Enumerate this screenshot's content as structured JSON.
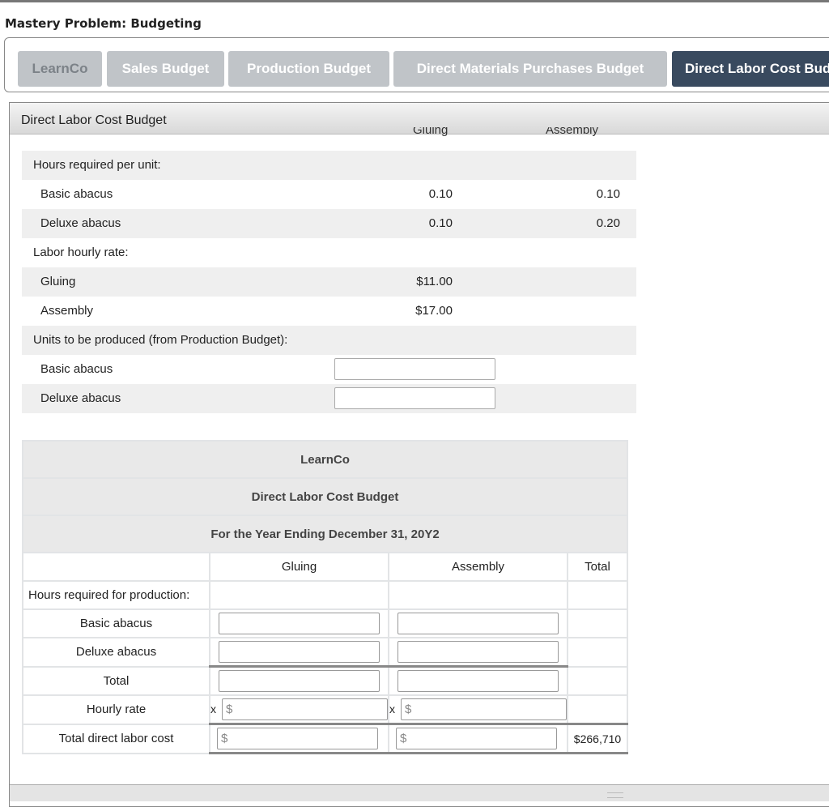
{
  "title": "Mastery Problem: Budgeting",
  "tabs": [
    {
      "label": "LearnCo"
    },
    {
      "label": "Sales Budget"
    },
    {
      "label": "Production Budget"
    },
    {
      "label": "Direct Materials Purchases Budget"
    },
    {
      "label": "Direct Labor Cost Budget"
    }
  ],
  "panel": {
    "title": "Direct Labor Cost Budget",
    "columns": [
      "Gluing",
      "Assembly"
    ],
    "rows": [
      {
        "label": "Hours required per unit:"
      },
      {
        "label": "Basic abacus",
        "gluing": "0.10",
        "assembly": "0.10"
      },
      {
        "label": "Deluxe abacus",
        "gluing": "0.10",
        "assembly": "0.20"
      },
      {
        "label": "Labor hourly rate:"
      },
      {
        "label": "Gluing",
        "gluing": "$11.00"
      },
      {
        "label": "Assembly",
        "gluing": "$17.00"
      },
      {
        "label": "Units to be produced (from Production Budget):"
      },
      {
        "label": "Basic abacus",
        "value": ""
      },
      {
        "label": "Deluxe abacus",
        "value": ""
      }
    ]
  },
  "budget": {
    "company": "LearnCo",
    "name": "Direct Labor Cost Budget",
    "period": "For the Year Ending December 31, 20Y2",
    "columns": [
      "Gluing",
      "Assembly",
      "Total"
    ],
    "rows": {
      "hours": "Hours required for production:",
      "basic": "Basic abacus",
      "deluxe": "Deluxe abacus",
      "total": "Total",
      "rate": "Hourly rate",
      "cost": "Total direct labor cost"
    },
    "x": "x",
    "currency": "$",
    "total_cost": "$266,710"
  }
}
